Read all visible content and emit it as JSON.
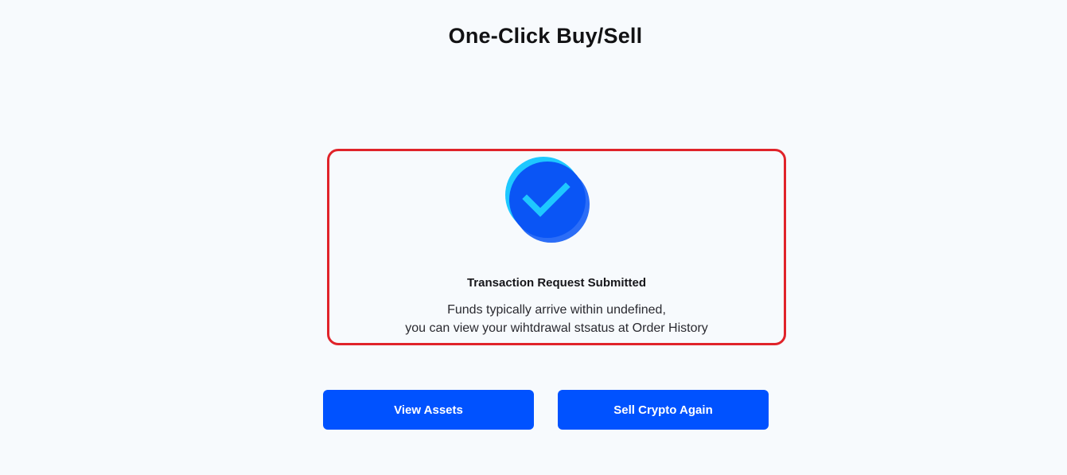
{
  "header": {
    "title": "One-Click Buy/Sell"
  },
  "result": {
    "icon": "check-circle-icon",
    "title": "Transaction Request Submitted",
    "message_line1": "Funds typically arrive within undefined,",
    "message_line2": "you can view your wihtdrawal stsatus at Order History"
  },
  "actions": {
    "view_assets_label": "View Assets",
    "sell_again_label": "Sell Crypto Again"
  },
  "colors": {
    "background": "#f7fafd",
    "primary_button": "#0052ff",
    "highlight_border": "#e0232a",
    "icon_cyan": "#1ec8ff",
    "icon_blue": "#0a55f5"
  }
}
